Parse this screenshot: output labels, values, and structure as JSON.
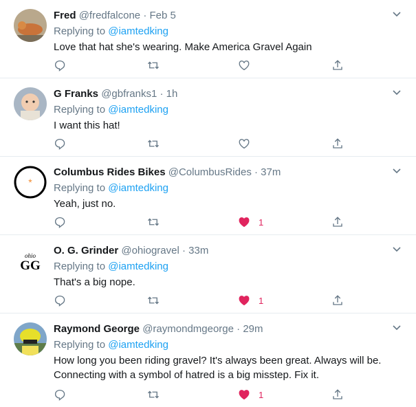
{
  "replying_label": "Replying to",
  "tweets": [
    {
      "name": "Fred",
      "handle": "@fredfalcone",
      "time": "Feb 5",
      "mention": "@iamtedking",
      "text": "Love that hat she's wearing. Make America Gravel Again",
      "liked": false,
      "likes": ""
    },
    {
      "name": "G Franks",
      "handle": "@gbfranks1",
      "time": "1h",
      "mention": "@iamtedking",
      "text": "I want this hat!",
      "liked": false,
      "likes": ""
    },
    {
      "name": "Columbus Rides Bikes",
      "handle": "@ColumbusRides",
      "time": "37m",
      "mention": "@iamtedking",
      "text": "Yeah, just no.",
      "liked": true,
      "likes": "1"
    },
    {
      "name": "O. G. Grinder",
      "handle": "@ohiogravel",
      "time": "33m",
      "mention": "@iamtedking",
      "text": "That's a big nope.",
      "liked": true,
      "likes": "1",
      "avatar_text_top": "ohio",
      "avatar_text_main": "GG"
    },
    {
      "name": "Raymond George",
      "handle": "@raymondmgeorge",
      "time": "29m",
      "mention": "@iamtedking",
      "text": "How long you been riding gravel? It's always been great. Always will be. Connecting with a symbol of hatred is a big misstep. Fix it.",
      "liked": true,
      "likes": "1"
    }
  ],
  "dot": "·",
  "colors": {
    "accent": "#1da1f2",
    "like": "#e0245e",
    "muted": "#657786"
  },
  "icons": [
    "reply-icon",
    "retweet-icon",
    "like-icon",
    "share-icon",
    "chevron-down-icon"
  ]
}
